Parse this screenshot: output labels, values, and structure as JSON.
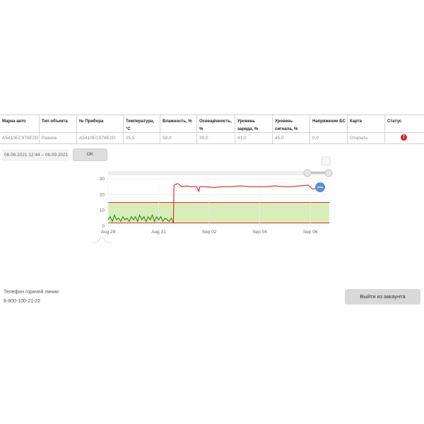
{
  "table": {
    "headers": [
      "Марка авто",
      "Тип объекта",
      "№ Прибора",
      "Температура,°С",
      "Влажность, %",
      "Освещённость, %",
      "Уровень заряда, %",
      "Уровень сигнала, %",
      "Напряжение БС",
      "Карта",
      "Статус"
    ],
    "row": {
      "brand": "A5410EC978E2D",
      "object_type": "Разное",
      "device_no": "A5410EC978E2D",
      "temperature": "25,5",
      "humidity": "58,0",
      "illuminance": "39,0",
      "charge": "41,0",
      "signal": "45,0",
      "voltage": "0,0",
      "map_link": "Открыть",
      "status_icon": "alert-icon",
      "status_glyph": "!"
    }
  },
  "filter": {
    "range": "06.06.2021 12:44 – 06.09.2021",
    "ok_label": "OK"
  },
  "chart_data": {
    "type": "line",
    "x_ticks": [
      "Aug 29",
      "Aug 31",
      "Sep 02",
      "Sep 04",
      "Sep 06"
    ],
    "y_ticks": [
      0,
      10,
      20,
      30
    ],
    "ylim": [
      0,
      30
    ],
    "xlim": [
      "2021-08-29",
      "2021-09-06 18:00"
    ],
    "threshold_band": [
      2,
      15
    ],
    "band_color": "#d9eeb6",
    "threshold_color": "#e03030",
    "series": [
      {
        "color": "#2b8a1e",
        "points": [
          [
            "2021-08-29 00:00",
            4
          ],
          [
            "2021-08-29 02:00",
            6
          ],
          [
            "2021-08-29 04:00",
            3
          ],
          [
            "2021-08-29 06:00",
            7
          ],
          [
            "2021-08-29 08:00",
            4
          ],
          [
            "2021-08-29 10:00",
            5
          ],
          [
            "2021-08-29 12:00",
            3
          ],
          [
            "2021-08-29 14:00",
            6
          ],
          [
            "2021-08-29 16:00",
            4
          ],
          [
            "2021-08-29 18:00",
            5
          ],
          [
            "2021-08-29 20:00",
            3
          ],
          [
            "2021-08-29 22:00",
            6
          ],
          [
            "2021-08-30 00:00",
            4
          ],
          [
            "2021-08-30 02:00",
            6
          ],
          [
            "2021-08-30 04:00",
            3
          ],
          [
            "2021-08-30 06:00",
            7
          ],
          [
            "2021-08-30 08:00",
            4
          ],
          [
            "2021-08-30 10:00",
            6
          ],
          [
            "2021-08-30 12:00",
            3
          ],
          [
            "2021-08-30 14:00",
            6
          ],
          [
            "2021-08-30 16:00",
            4
          ],
          [
            "2021-08-30 18:00",
            7
          ],
          [
            "2021-08-30 20:00",
            3
          ],
          [
            "2021-08-30 22:00",
            6
          ],
          [
            "2021-08-31 00:00",
            4
          ],
          [
            "2021-08-31 02:00",
            6
          ],
          [
            "2021-08-31 04:00",
            3
          ],
          [
            "2021-08-31 06:00",
            5
          ],
          [
            "2021-08-31 08:00",
            4
          ],
          [
            "2021-08-31 10:00",
            3
          ],
          [
            "2021-08-31 12:00",
            5
          ],
          [
            "2021-08-31 14:00",
            2
          ]
        ]
      },
      {
        "color": "#e02020",
        "points": [
          [
            "2021-08-31 14:00",
            2
          ],
          [
            "2021-08-31 14:30",
            26
          ],
          [
            "2021-08-31 18:00",
            27
          ],
          [
            "2021-08-31 22:00",
            25
          ],
          [
            "2021-09-01 02:00",
            25.5
          ],
          [
            "2021-09-01 06:00",
            25
          ],
          [
            "2021-09-01 12:00",
            25
          ],
          [
            "2021-09-01 14:00",
            22
          ],
          [
            "2021-09-01 15:00",
            25
          ],
          [
            "2021-09-01 20:00",
            25
          ],
          [
            "2021-09-02 04:00",
            24.5
          ],
          [
            "2021-09-02 12:00",
            25
          ],
          [
            "2021-09-02 20:00",
            25
          ],
          [
            "2021-09-03 06:00",
            25.5
          ],
          [
            "2021-09-03 14:00",
            25
          ],
          [
            "2021-09-03 22:00",
            25
          ],
          [
            "2021-09-04 06:00",
            25
          ],
          [
            "2021-09-04 14:00",
            25.5
          ],
          [
            "2021-09-04 22:00",
            25
          ],
          [
            "2021-09-05 06:00",
            25
          ],
          [
            "2021-09-05 14:00",
            25.5
          ],
          [
            "2021-09-05 22:00",
            26
          ],
          [
            "2021-09-06 02:00",
            23.5
          ],
          [
            "2021-09-06 06:00",
            24
          ],
          [
            "2021-09-06 10:00",
            25
          ],
          [
            "2021-09-06 14:00",
            25.5
          ]
        ]
      }
    ],
    "grid": true
  },
  "footer": {
    "hotline_label": "Телефон горячей линии",
    "hotline_phone": "8-800-100-21-22",
    "logout_label": "Выйти из аккаунта"
  }
}
